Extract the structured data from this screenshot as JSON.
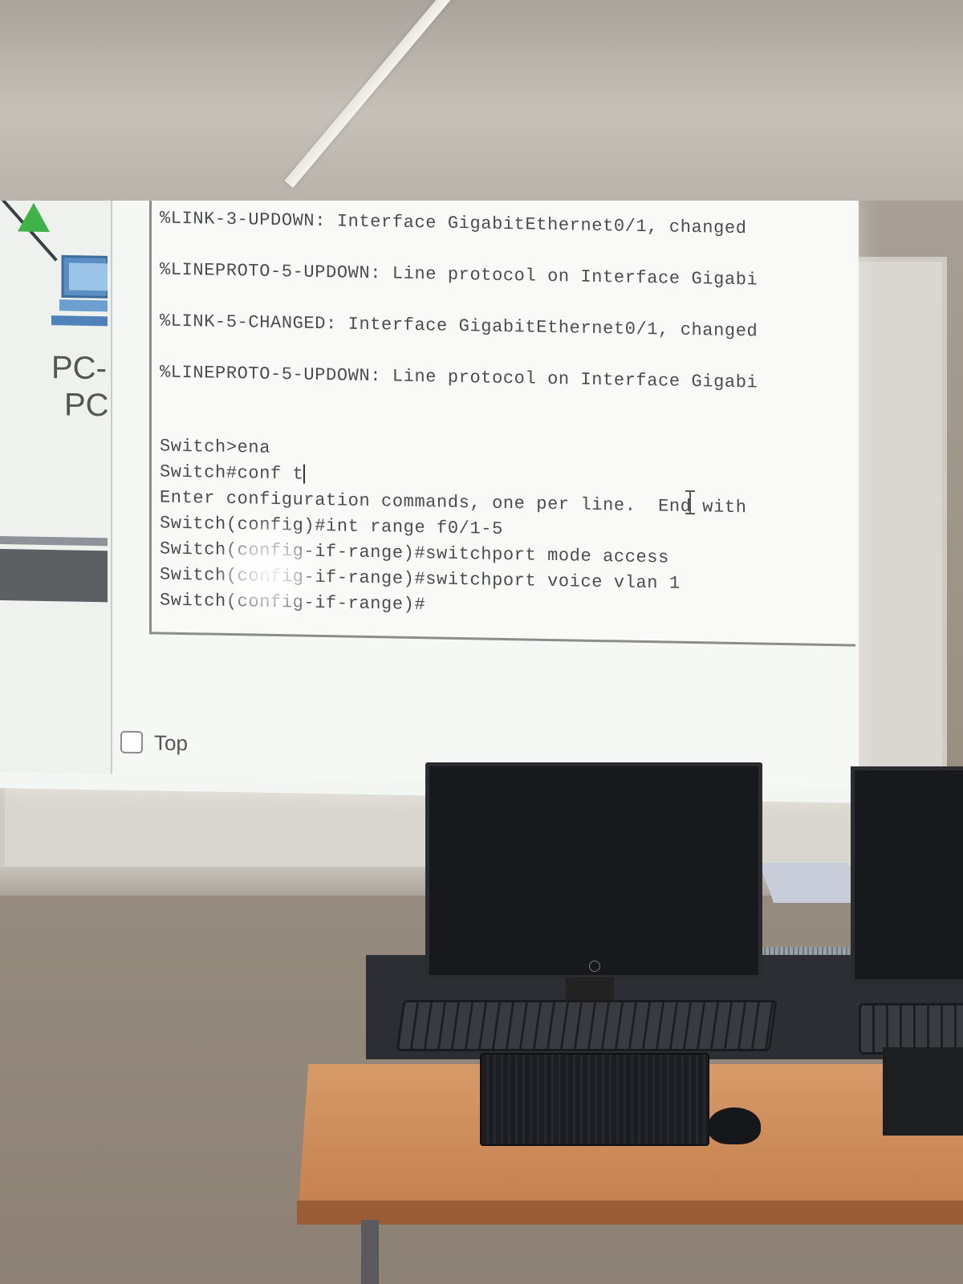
{
  "topology": {
    "pc_label_line1": "PC-",
    "pc_label_line2": "PC"
  },
  "terminal": {
    "lines": [
      "%LINK-3-UPDOWN: Interface GigabitEthernet0/1, changed",
      "%LINEPROTO-5-UPDOWN: Line protocol on Interface Gigabi",
      "%LINK-5-CHANGED: Interface GigabitEthernet0/1, changed",
      "%LINEPROTO-5-UPDOWN: Line protocol on Interface Gigabi",
      "Switch>ena",
      "Switch#conf t",
      "Enter configuration commands, one per line.  End with",
      "Switch(config)#int range f0/1-5",
      "Switch(config-if-range)#switchport mode access",
      "Switch(config-if-range)#switchport voice vlan 1",
      "Switch(config-if-range)#"
    ]
  },
  "top_checkbox": {
    "label": "Top",
    "checked": false
  },
  "colors": {
    "terminal_text": "#4a4d50",
    "link_triangle": "#3fb24a",
    "desk": "#c5804f"
  },
  "icons": [
    "pc-icon",
    "link-triangle-icon",
    "checkbox-icon",
    "text-cursor-icon"
  ]
}
